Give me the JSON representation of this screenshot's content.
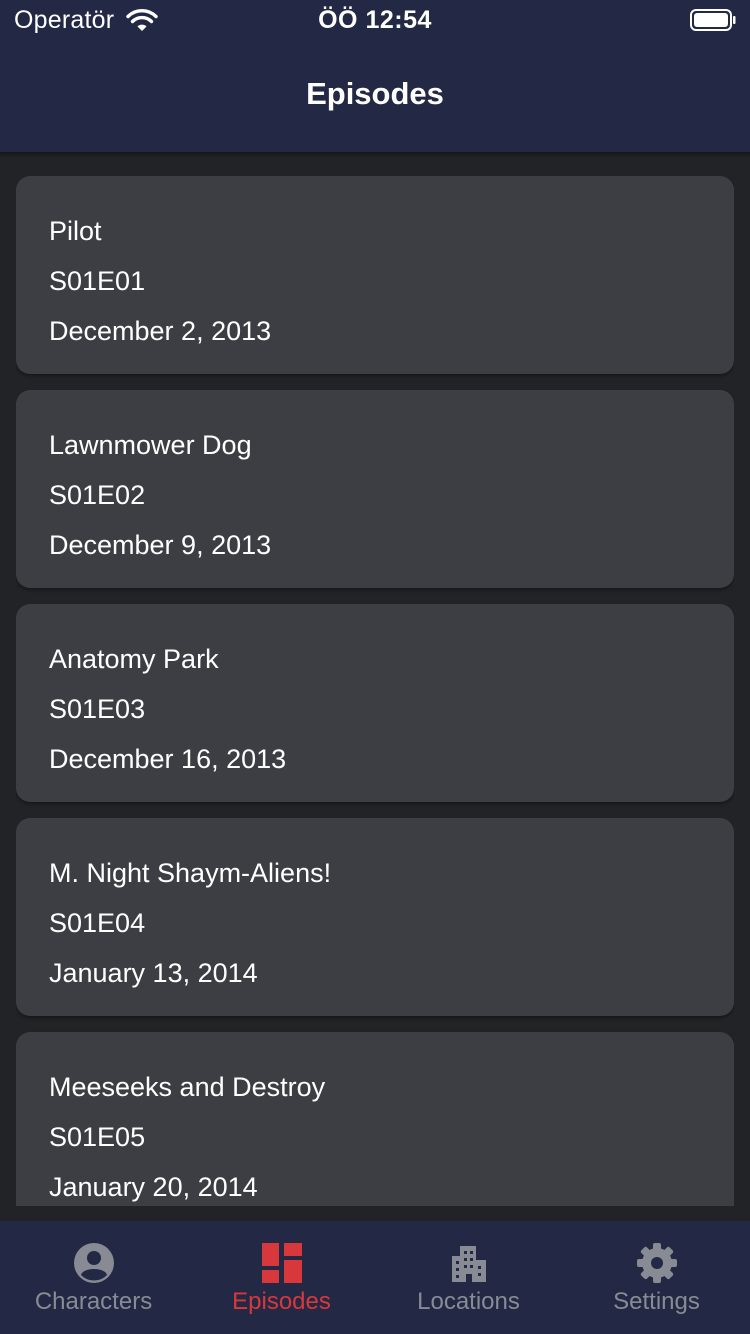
{
  "status_bar": {
    "carrier": "Operatör",
    "time": "ÖÖ 12:54",
    "wifi_icon": "wifi-icon",
    "battery_icon": "battery-icon"
  },
  "header": {
    "title": "Episodes"
  },
  "episodes": [
    {
      "name": "Pilot",
      "code": "S01E01",
      "air_date": "December 2, 2013"
    },
    {
      "name": "Lawnmower Dog",
      "code": "S01E02",
      "air_date": "December 9, 2013"
    },
    {
      "name": "Anatomy Park",
      "code": "S01E03",
      "air_date": "December 16, 2013"
    },
    {
      "name": "M. Night Shaym-Aliens!",
      "code": "S01E04",
      "air_date": "January 13, 2014"
    },
    {
      "name": "Meeseeks and Destroy",
      "code": "S01E05",
      "air_date": "January 20, 2014"
    }
  ],
  "tabbar": {
    "tabs": [
      {
        "label": "Characters",
        "icon": "person-icon",
        "active": false
      },
      {
        "label": "Episodes",
        "icon": "dashboard-icon",
        "active": true
      },
      {
        "label": "Locations",
        "icon": "building-icon",
        "active": false
      },
      {
        "label": "Settings",
        "icon": "gear-icon",
        "active": false
      }
    ]
  },
  "colors": {
    "header_bg": "#232845",
    "page_bg": "#212327",
    "card_bg": "#3c3e43",
    "active_tab": "#d8383b",
    "inactive_tab": "#888b94"
  }
}
